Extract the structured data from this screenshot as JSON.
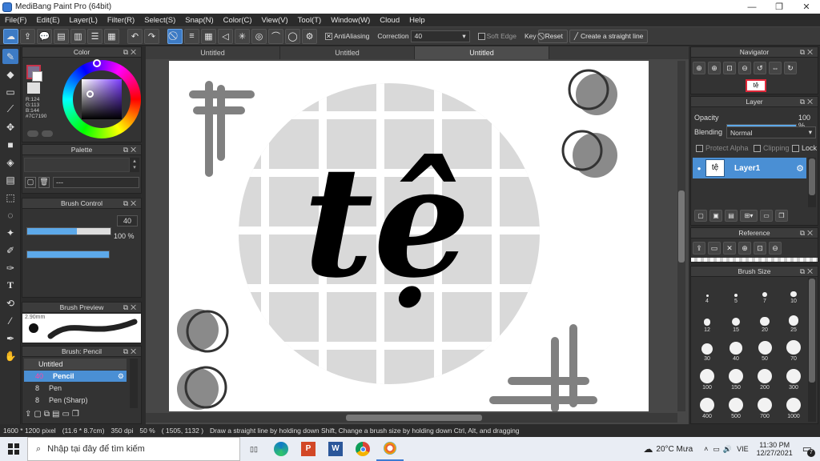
{
  "window": {
    "title": "MediBang Paint Pro (64bit)",
    "minimize": "—",
    "restore": "❐",
    "close": "✕"
  },
  "menu": [
    "File(F)",
    "Edit(E)",
    "Layer(L)",
    "Filter(R)",
    "Select(S)",
    "Snap(N)",
    "Color(C)",
    "View(V)",
    "Tool(T)",
    "Window(W)",
    "Cloud",
    "Help"
  ],
  "toolbar": {
    "antialiasing_label": "AntiAliasing",
    "correction_label": "Correction",
    "correction_value": "40",
    "soft_edge_label": "Soft Edge",
    "key_label": "Key",
    "reset_label": "Reset",
    "straight_line_label": "Create a straight line"
  },
  "tabs": [
    "Untitled",
    "Untitled",
    "Untitled"
  ],
  "color_panel": {
    "title": "Color",
    "r": "R:124",
    "g": "G:113",
    "b": "B:144",
    "hex": "#7C7190",
    "primary_color": "#7C7190"
  },
  "palette_panel": {
    "title": "Palette",
    "entry": "---"
  },
  "brush_control": {
    "title": "Brush Control",
    "size_value": "40",
    "size_fraction": 0.6,
    "opacity_value": "100 %"
  },
  "brush_preview": {
    "title": "Brush Preview",
    "size": "2.90mm"
  },
  "brush_list": {
    "title": "Brush: Pencil",
    "group": "Untitled",
    "items": [
      {
        "size": "40",
        "name": "Pencil"
      },
      {
        "size": "8",
        "name": "Pen"
      },
      {
        "size": "8",
        "name": "Pen (Sharp)"
      }
    ]
  },
  "navigator": {
    "title": "Navigator"
  },
  "layer_panel": {
    "title": "Layer",
    "opacity_label": "Opacity",
    "opacity_value": "100 %",
    "blending_label": "Blending",
    "blending_value": "Normal",
    "protect_alpha": "Protect Alpha",
    "clipping": "Clipping",
    "lock": "Lock",
    "layer_name": "Layer1",
    "layer_thumb": "tệ"
  },
  "reference_panel": {
    "title": "Reference"
  },
  "brush_size_panel": {
    "title": "Brush Size",
    "sizes": [
      "4",
      "5",
      "7",
      "10",
      "12",
      "15",
      "20",
      "25",
      "30",
      "40",
      "50",
      "70",
      "100",
      "150",
      "200",
      "300",
      "400",
      "500",
      "700",
      "1000"
    ]
  },
  "canvas_text": "tệ",
  "status": {
    "dims": "1600 * 1200 pixel",
    "cm": "(11.6 * 8.7cm)",
    "dpi": "350 dpi",
    "zoom": "50 %",
    "coords": "( 1505, 1132 )",
    "hint": "Draw a straight line by holding down Shift, Change a brush size by holding down Ctrl, Alt, and dragging"
  },
  "taskbar": {
    "search_placeholder": "Nhập tại đây để tìm kiếm",
    "weather": "20°C  Mưa",
    "lang": "VIE",
    "time": "11:30 PM",
    "date": "12/27/2021",
    "notif": "7"
  }
}
